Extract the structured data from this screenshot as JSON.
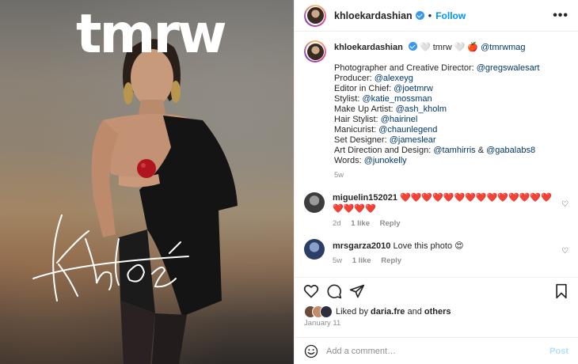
{
  "media": {
    "magazine_title": "tmrw",
    "signature_text": "Khloé"
  },
  "header": {
    "username": "khloekardashian",
    "separator": "•",
    "follow_label": "Follow",
    "more_icon": "more-horizontal-icon"
  },
  "caption": {
    "username": "khloekardashian",
    "emoji_1": "🤍",
    "word": "tmrw",
    "emoji_2": "🤍",
    "emoji_3": "🍎",
    "mention": "@tmrwmag",
    "credits": [
      {
        "role": "Photographer and Creative Director: ",
        "handle": "@gregswalesart"
      },
      {
        "role": "Producer: ",
        "handle": "@alexeyg"
      },
      {
        "role": "Editor in Chief: ",
        "handle": "@joetmrw"
      },
      {
        "role": "Stylist: ",
        "handle": "@katie_mossman"
      },
      {
        "role": "Make Up Artist: ",
        "handle": "@ash_kholm"
      },
      {
        "role": "Hair Stylist: ",
        "handle": "@hairinel"
      },
      {
        "role": "Manicurist: ",
        "handle": "@chaunlegend"
      },
      {
        "role": "Set Designer: ",
        "handle": "@jameslear"
      }
    ],
    "art_direction_role": "Art Direction and Design: ",
    "art_direction_handle_1": "@tamhirris",
    "art_direction_amp": " & ",
    "art_direction_handle_2": "@gabalabs8",
    "words_role": "Words: ",
    "words_handle": "@junokelly",
    "age": "5w"
  },
  "comments": [
    {
      "username": "miguelin152021",
      "text": "❤️❤️❤️❤️❤️❤️❤️❤️❤️❤️❤️❤️❤️❤️❤️❤️❤️❤️",
      "age": "2d",
      "likes": "1 like",
      "reply": "Reply"
    },
    {
      "username": "mrsgarza2010",
      "text": "Love this photo 😍",
      "age": "5w",
      "likes": "1 like",
      "reply": "Reply"
    }
  ],
  "actions": {
    "like_icon": "heart-icon",
    "comment_icon": "comment-icon",
    "share_icon": "share-icon",
    "save_icon": "bookmark-icon"
  },
  "likes": {
    "prefix": "Liked by ",
    "user": "daria.fre",
    "middle": " and ",
    "others": "others"
  },
  "date": "January 11",
  "add_comment": {
    "placeholder": "Add a comment…",
    "post_label": "Post",
    "emoji_icon": "smiley-icon"
  },
  "colors": {
    "accent": "#0095f6",
    "mention": "#00376b",
    "muted": "#8e8e8e",
    "post_disabled": "#b2dffc"
  }
}
